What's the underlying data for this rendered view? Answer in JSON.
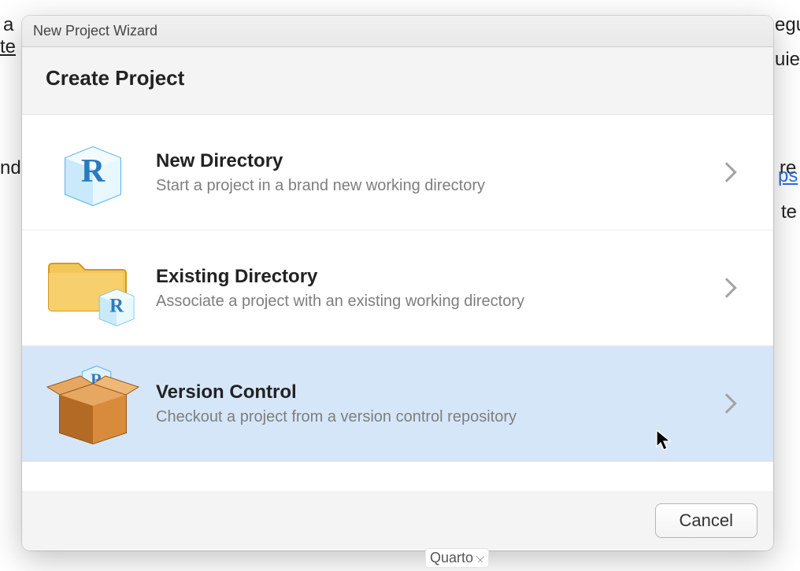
{
  "dialog": {
    "titlebar": "New Project Wizard",
    "header": "Create Project",
    "options": [
      {
        "title": "New Directory",
        "desc": "Start a project in a brand new working directory"
      },
      {
        "title": "Existing Directory",
        "desc": "Associate a project with an existing working directory"
      },
      {
        "title": "Version Control",
        "desc": "Checkout a project from a version control repository"
      }
    ],
    "cancel": "Cancel"
  },
  "background_fragments": {
    "a": "a",
    "te": "te",
    "nc": "nd",
    "egu": "egu",
    "uie": "uie",
    "re": "re",
    "ps": "ps",
    "te2": "te"
  },
  "status": {
    "dropdown": "Quarto"
  }
}
